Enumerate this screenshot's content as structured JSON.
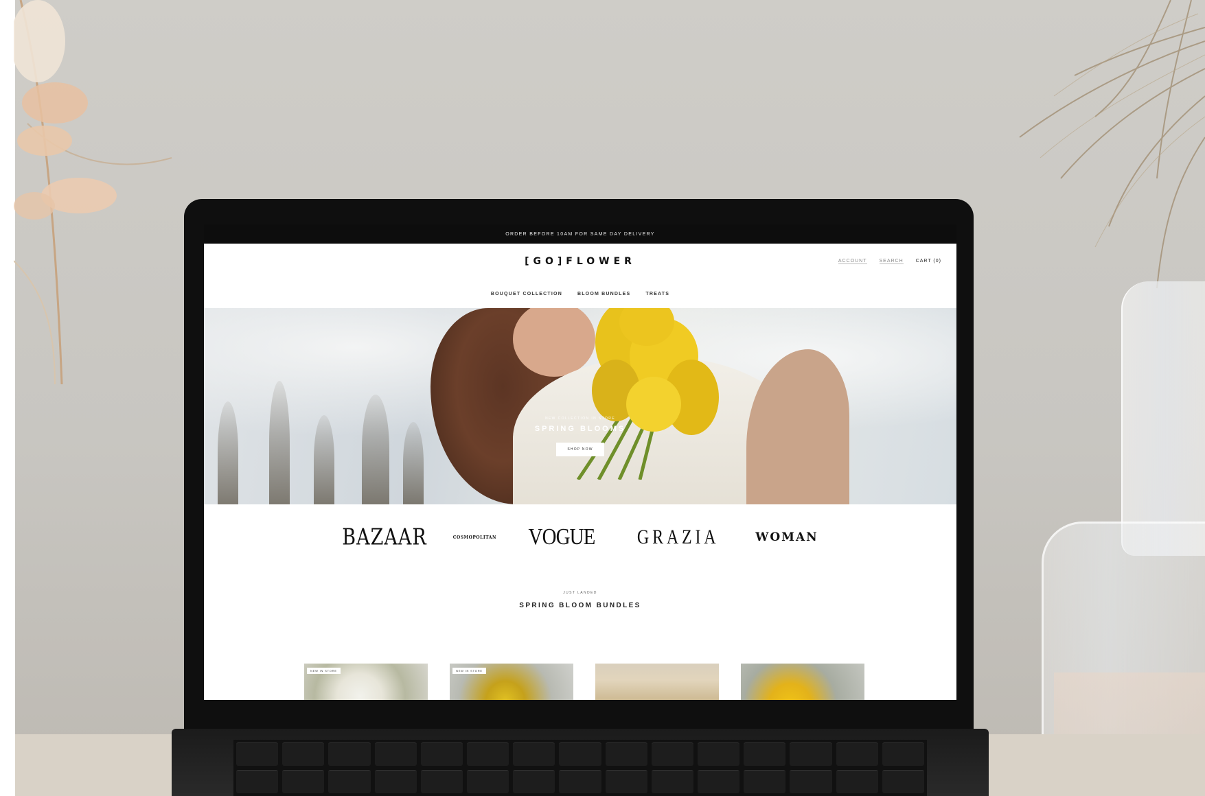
{
  "site": {
    "promo_bar": "ORDER BEFORE 10AM FOR SAME DAY DELIVERY",
    "logo": "[GO]FLOWER",
    "header_links": [
      "ACCOUNT",
      "SEARCH",
      "CART (0)"
    ],
    "nav": [
      "BOUQUET COLLECTION",
      "BLOOM BUNDLES",
      "TREATS"
    ]
  },
  "hero": {
    "subtitle": "NEW COLLECTION IN STORE",
    "title": "SPRING BLOOMS",
    "button": "SHOP NOW"
  },
  "press": {
    "logos": [
      "BAZAAR",
      "COSMOPOLITAN",
      "VOGUE",
      "GRAZIA",
      "WOMAN"
    ]
  },
  "section": {
    "kicker": "JUST LANDED",
    "title": "SPRING BLOOM BUNDLES"
  },
  "products": {
    "badges": [
      "NEW IN STORE",
      "NEW IN STORE"
    ]
  },
  "colors": {
    "promo_bg": "#0d0d0d",
    "flower_yellow": "#e3b21a",
    "page_bg": "#ffffff"
  }
}
